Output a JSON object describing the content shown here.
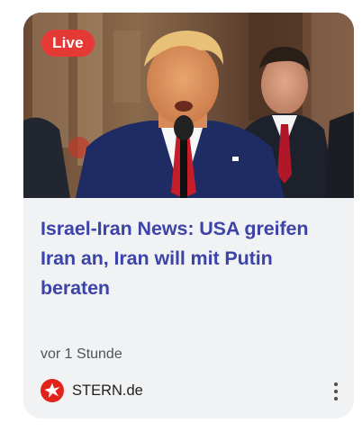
{
  "card": {
    "badge": "Live",
    "headline": "Israel-Iran News: USA greifen Iran an, Iran will mit Putin beraten",
    "time": "vor 1 Stunde",
    "source": {
      "name": "STERN.de",
      "logo_icon": "stern-logo-icon",
      "logo_color": "#e2231a"
    },
    "menu_icon": "more-vert-icon"
  },
  "colors": {
    "headline": "#3d44a8",
    "badge": "#e53935",
    "card_background": "#f1f2f4"
  }
}
